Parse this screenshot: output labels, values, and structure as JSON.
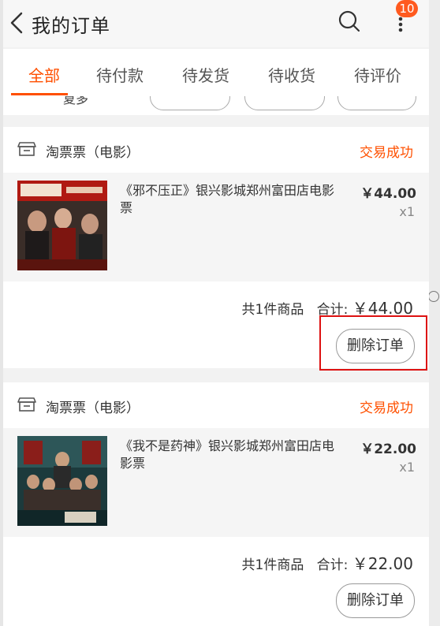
{
  "header": {
    "title": "我的订单",
    "badge_count": "10"
  },
  "tabs": [
    {
      "label": "全部",
      "active": true
    },
    {
      "label": "待付款"
    },
    {
      "label": "待发货"
    },
    {
      "label": "待收货"
    },
    {
      "label": "待评价"
    }
  ],
  "orders": [
    {
      "store": "淘票票（电影）",
      "status": "交易成功",
      "item_title": "《邪不压正》银兴影城郑州富田店电影票",
      "price": "￥44.00",
      "qty": "x1",
      "count_text": "共1件商品",
      "total_label": "合计:",
      "total_value": "￥44.00",
      "delete_label": "删除订单"
    },
    {
      "store": "淘票票（电影）",
      "status": "交易成功",
      "item_title": "《我不是药神》银兴影城郑州富田店电影票",
      "price": "￥22.00",
      "qty": "x1",
      "count_text": "共1件商品",
      "total_label": "合计:",
      "total_value": "￥22.00",
      "delete_label": "删除订单"
    }
  ],
  "colors": {
    "accent": "#ff4f00",
    "status": "#ff5000",
    "badge": "#ff5a1f",
    "highlight": "#dd1111"
  }
}
